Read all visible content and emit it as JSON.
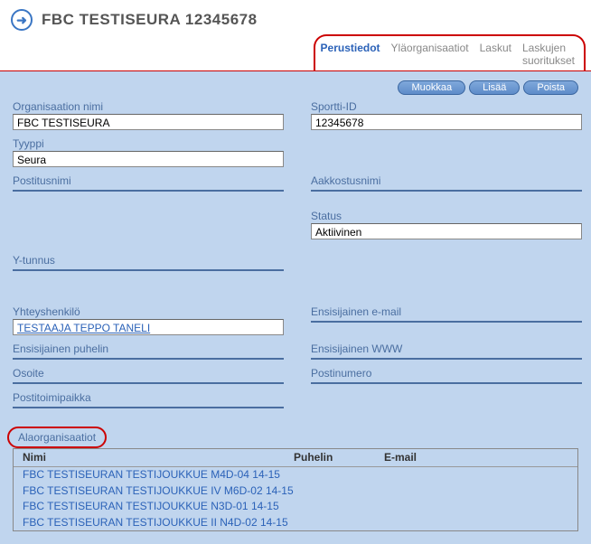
{
  "header": {
    "title": "FBC TESTISEURA 12345678"
  },
  "tabs": {
    "perustiedot": "Perustiedot",
    "ylaorganisaatiot": "Yläorganisaatiot",
    "laskut": "Laskut",
    "laskujen_suoritukset": "Laskujen suoritukset"
  },
  "toolbar": {
    "muokkaa": "Muokkaa",
    "lisaa": "Lisää",
    "poista": "Poista"
  },
  "fields": {
    "organisaation_nimi": {
      "label": "Organisaation nimi",
      "value": "FBC TESTISEURA"
    },
    "sportti_id": {
      "label": "Sportti-ID",
      "value": "12345678"
    },
    "tyyppi": {
      "label": "Tyyppi",
      "value": "Seura"
    },
    "postitusnimi": {
      "label": "Postitusnimi",
      "value": ""
    },
    "aakkostusnimi": {
      "label": "Aakkostusnimi",
      "value": ""
    },
    "status": {
      "label": "Status",
      "value": "Aktiivinen"
    },
    "ytunnus": {
      "label": "Y-tunnus",
      "value": ""
    },
    "yhteyshenkilo": {
      "label": "Yhteyshenkilö",
      "value": "TESTAAJA TEPPO TANELI"
    },
    "ensisijainen_email": {
      "label": "Ensisijainen e-mail",
      "value": ""
    },
    "ensisijainen_puhelin": {
      "label": "Ensisijainen puhelin",
      "value": ""
    },
    "ensisijainen_www": {
      "label": "Ensisijainen WWW",
      "value": ""
    },
    "osoite": {
      "label": "Osoite",
      "value": ""
    },
    "postinumero": {
      "label": "Postinumero",
      "value": ""
    },
    "postitoimipaikka": {
      "label": "Postitoimipaikka",
      "value": ""
    }
  },
  "section": {
    "tab": "Alaorganisaatiot",
    "columns": {
      "nimi": "Nimi",
      "puhelin": "Puhelin",
      "email": "E-mail"
    },
    "rows": [
      "FBC TESTISEURAN TESTIJOUKKUE M4D-04 14-15",
      "FBC TESTISEURAN TESTIJOUKKUE IV M6D-02 14-15",
      "FBC TESTISEURAN TESTIJOUKKUE N3D-01 14-15",
      "FBC TESTISEURAN TESTIJOUKKUE II N4D-02 14-15"
    ]
  }
}
